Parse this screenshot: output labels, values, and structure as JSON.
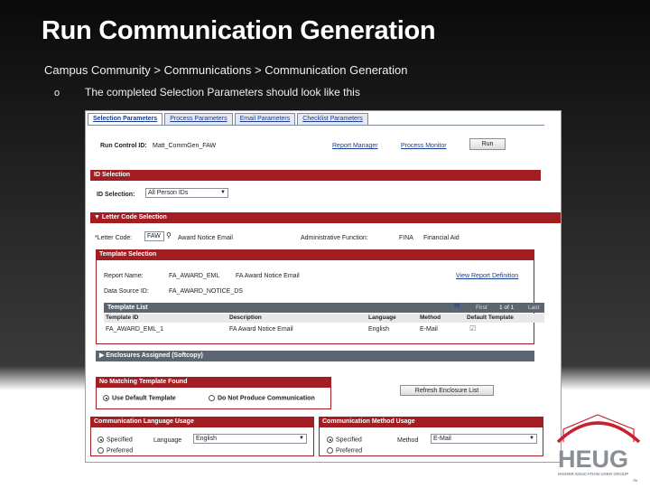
{
  "slide": {
    "title": "Run Communication Generation",
    "breadcrumb": "Campus Community > Communications > Communication Generation",
    "bullet_glyph": "o",
    "bullet_text": "The completed Selection Parameters should look like this"
  },
  "tabs": [
    {
      "label": "Selection Parameters",
      "active": true
    },
    {
      "label": "Process Parameters",
      "active": false
    },
    {
      "label": "Email Parameters",
      "active": false
    },
    {
      "label": "Checklist Parameters",
      "active": false
    }
  ],
  "run_control": {
    "label": "Run Control ID:",
    "value": "Matt_CommGen_FAW",
    "report_manager": "Report Manager",
    "process_monitor": "Process Monitor",
    "run_button": "Run"
  },
  "id_selection": {
    "header": "ID Selection",
    "label": "ID Selection:",
    "value": "All Person IDs"
  },
  "letter_code": {
    "header": "Letter Code Selection",
    "label": "*Letter Code:",
    "code": "FAW",
    "description": "Award Notice Email",
    "admin_label": "Administrative Function:",
    "admin_code": "FINA",
    "admin_desc": "Financial Aid"
  },
  "template_selection": {
    "header": "Template Selection",
    "report_name_label": "Report Name:",
    "report_name": "FA_AWARD_EML",
    "report_desc": "FA Award Notice Email",
    "view_link": "View Report Definition",
    "data_source_label": "Data Source ID:",
    "data_source": "FA_AWARD_NOTICE_DS"
  },
  "template_list": {
    "header": "Template List",
    "nav": {
      "first": "First",
      "range": "1 of 1",
      "last": "Last"
    },
    "columns": [
      "Template ID",
      "Description",
      "Language",
      "Method",
      "Default Template"
    ],
    "rows": [
      [
        "FA_AWARD_EML_1",
        "FA Award Notice Email",
        "English",
        "E-Mail",
        "checked"
      ]
    ]
  },
  "enclosures": {
    "header": "Enclosures Assigned (Softcopy)"
  },
  "no_match": {
    "header": "No Matching Template Found",
    "opt1": "Use Default Template",
    "opt2": "Do Not Produce Communication",
    "refresh_button": "Refresh Enclosure List"
  },
  "language_usage": {
    "header": "Communication Language Usage",
    "specified": "Specified",
    "preferred": "Preferred",
    "language_label": "Language",
    "language_value": "English"
  },
  "method_usage": {
    "header": "Communication Method Usage",
    "specified": "Specified",
    "preferred": "Preferred",
    "method_label": "Method",
    "method_value": "E-Mail"
  },
  "logo": {
    "text": "HEUG",
    "tagline": "HIGHER EDUCATION USER GROUP",
    "tm": "TM",
    "colors": {
      "red": "#c8202f",
      "grey": "#8a8f96"
    }
  }
}
